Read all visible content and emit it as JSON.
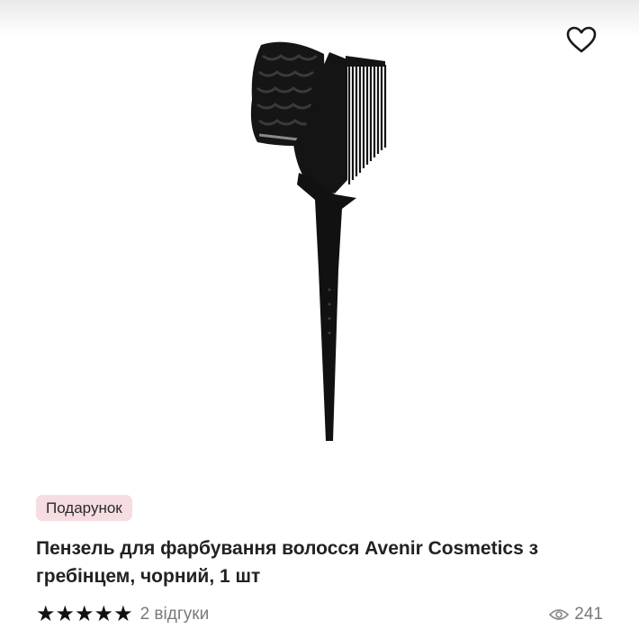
{
  "product": {
    "badge": "Подарунок",
    "title": "Пензель для фарбування волосся Avenir Cosmetics з гребінцем, чорний, 1 шт",
    "image_alt": "hair-dye-brush-with-comb",
    "rating": 5,
    "stars": [
      "★",
      "★",
      "★",
      "★",
      "★"
    ],
    "reviews_label": "2 відгуки",
    "views_count": "241"
  },
  "icons": {
    "wishlist": "heart-outline-icon",
    "views": "eye-icon",
    "star": "star-icon"
  },
  "colors": {
    "badge_bg": "#f6dde2",
    "text": "#222222",
    "muted": "#7a7a7a",
    "star": "#111111"
  }
}
